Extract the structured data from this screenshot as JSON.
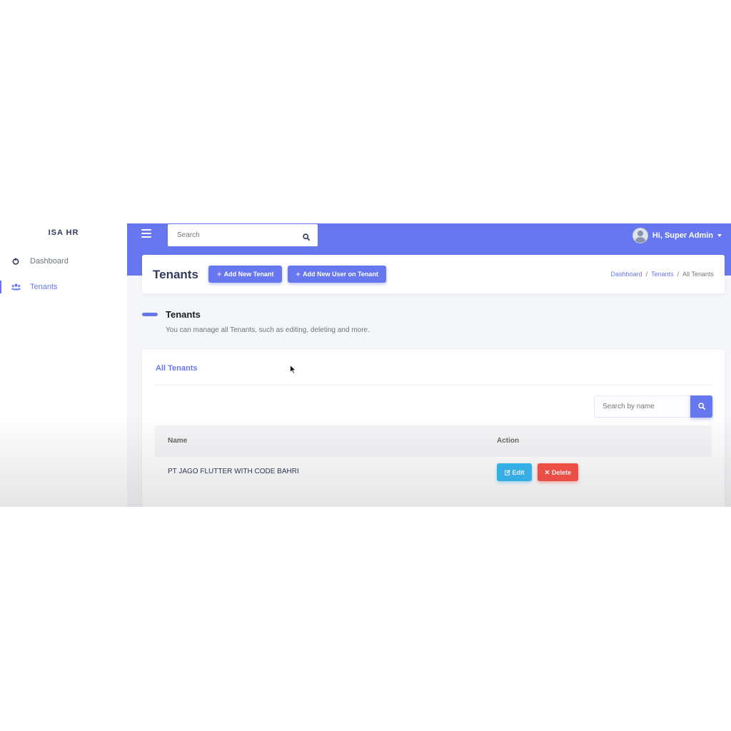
{
  "sidebar": {
    "brand": "ISA HR",
    "items": [
      {
        "label": "Dashboard",
        "icon": "dashboard-icon",
        "active": false
      },
      {
        "label": "Tenants",
        "icon": "users-icon",
        "active": true
      }
    ]
  },
  "topbar": {
    "search_placeholder": "Search",
    "user_greeting": "Hi, Super Admin"
  },
  "section_header": {
    "title": "Tenants",
    "add_tenant_label": "Add New Tenant",
    "add_user_label": "Add New User on Tenant",
    "breadcrumb": [
      "Dashboard",
      "Tenants",
      "All Tenants"
    ]
  },
  "section_body": {
    "title": "Tenants",
    "lead": "You can manage all Tenants, such as editing, deleting and more."
  },
  "card": {
    "title": "All Tenants",
    "search_placeholder": "Search by name",
    "columns": [
      "Name",
      "Action"
    ],
    "rows": [
      {
        "name": "PT JAGO FLUTTER WITH CODE BAHRI",
        "edit_label": "Edit",
        "delete_label": "Delete"
      }
    ]
  },
  "colors": {
    "primary": "#6777ef",
    "info": "#3abaf4",
    "danger": "#fc544b"
  }
}
